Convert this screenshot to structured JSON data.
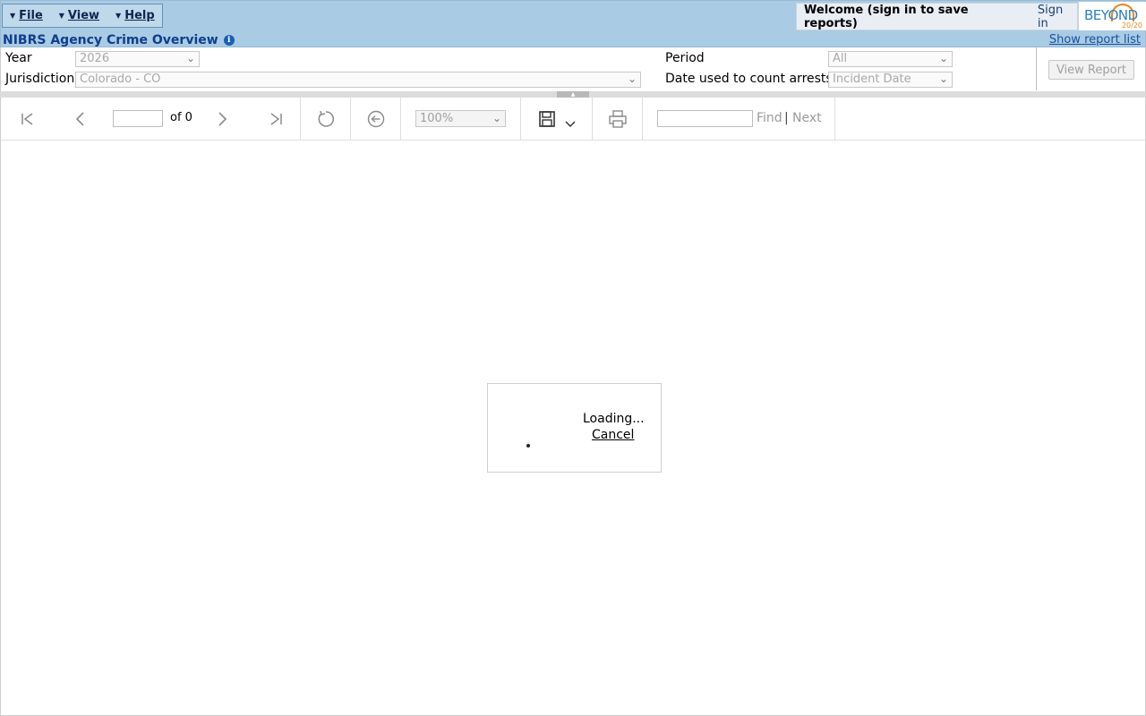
{
  "menu": {
    "items": [
      {
        "label": "File"
      },
      {
        "label": "View"
      },
      {
        "label": "Help"
      }
    ]
  },
  "header": {
    "welcome": "Welcome (sign in to save reports)",
    "signin": "Sign in",
    "logo_text": "BEYOND",
    "logo_sub": "20/20",
    "title": "NIBRS Agency Crime Overview",
    "show_report_list": "Show report list"
  },
  "params": {
    "year_label": "Year",
    "year_value": "2026",
    "jurisdiction_label": "Jurisdiction",
    "jurisdiction_value": "Colorado - CO",
    "period_label": "Period",
    "period_value": "All",
    "date_label": "Date used to count arrests",
    "date_value": "Incident Date",
    "view_report": "View Report"
  },
  "toolbar": {
    "page_of": "of 0",
    "zoom": "100%",
    "find": "Find",
    "separator": "|",
    "next": "Next"
  },
  "loading": {
    "text": "Loading...",
    "cancel": "Cancel"
  },
  "colors": {
    "header_bg": "#a9cbe3",
    "title_blue": "#0f3e8c",
    "logo_orange": "#e7871e",
    "logo_blue": "#2f7fc1"
  }
}
